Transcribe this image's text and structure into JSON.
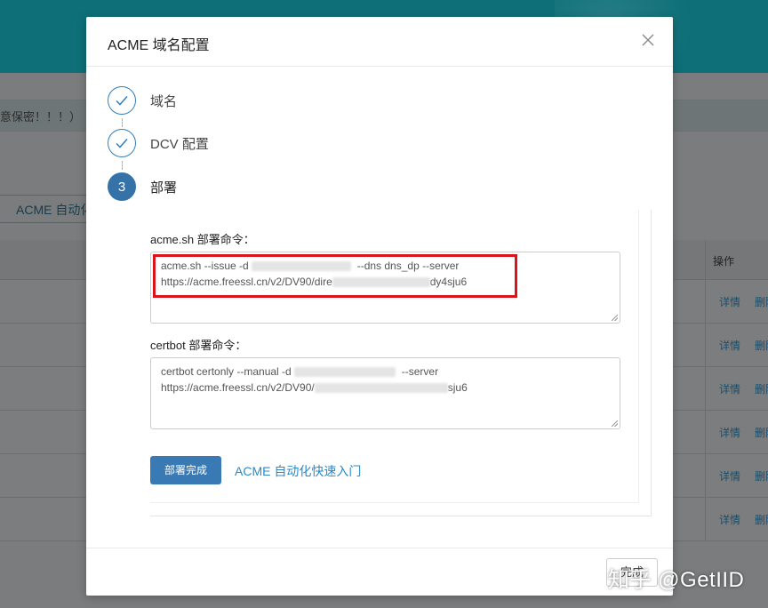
{
  "background": {
    "notice_text": "意保密！！！）",
    "acme_button_label": "ACME 自动化",
    "table": {
      "op_header": "操作",
      "rows": [
        {
          "detail": "详情",
          "delete": "删除"
        },
        {
          "detail": "详情",
          "delete": "删除"
        },
        {
          "detail": "详情",
          "delete": "删除"
        },
        {
          "detail": "详情",
          "delete": "删除"
        },
        {
          "detail": "详情",
          "delete": "删除"
        },
        {
          "detail": "详情",
          "delete": "删除"
        }
      ]
    }
  },
  "modal": {
    "title": "ACME 域名配置",
    "close_symbol": "X",
    "steps": [
      {
        "label": "域名",
        "status": "done",
        "icon": "check-icon"
      },
      {
        "label": "DCV 配置",
        "status": "done",
        "icon": "check-icon"
      },
      {
        "label": "部署",
        "status": "active",
        "number": "3"
      }
    ],
    "acme_sh": {
      "label": "acme.sh 部署命令：",
      "line1_start": "acme.sh --issue -d ",
      "line1_end": "--dns dns_dp --server",
      "line2_start": "https://acme.freessl.cn/v2/DV90/dire",
      "line2_end": "dy4sju6"
    },
    "certbot": {
      "label": "certbot 部署命令：",
      "line1_start": "certbot certonly --manual -d ",
      "line1_end": "--server",
      "line2_start": "https://acme.freessl.cn/v2/DV90/",
      "line2_end": "sju6"
    },
    "deploy_button": "部署完成",
    "guide_link": "ACME 自动化快速入门",
    "footer_button": "完成"
  },
  "watermark": "知乎 @GetIID",
  "colors": {
    "primary": "#3a7ab4",
    "link": "#2b89c4",
    "highlight": "#d9141b",
    "step": "#2f7fc0"
  }
}
